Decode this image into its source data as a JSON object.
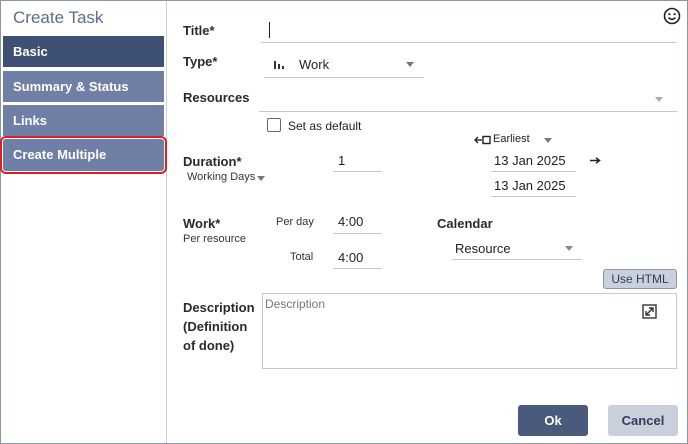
{
  "dialog": {
    "title": "Create Task"
  },
  "sidebar": {
    "items": [
      {
        "label": "Basic"
      },
      {
        "label": "Summary & Status"
      },
      {
        "label": "Links"
      },
      {
        "label": "Create Multiple"
      }
    ]
  },
  "form": {
    "title": {
      "label": "Title*",
      "value": ""
    },
    "type": {
      "label": "Type*",
      "value": "Work",
      "icon": "bar-chart-icon"
    },
    "resources": {
      "label": "Resources",
      "value": ""
    },
    "set_default": {
      "label": "Set as default",
      "checked": false
    },
    "duration": {
      "label": "Duration*",
      "unit": "Working Days",
      "value": "1"
    },
    "schedule": {
      "mode": "Earliest",
      "start_date": "13 Jan 2025",
      "end_date": "13 Jan 2025"
    },
    "work": {
      "label": "Work*",
      "sublabel": "Per resource",
      "per_day_label": "Per day",
      "per_day_value": "4:00",
      "total_label": "Total",
      "total_value": "4:00"
    },
    "calendar": {
      "label": "Calendar",
      "value": "Resource"
    },
    "use_html": {
      "label": "Use HTML"
    },
    "description": {
      "label_line1": "Description",
      "label_line2": "(Definition",
      "label_line3": "of done)",
      "placeholder": "Description"
    }
  },
  "footer": {
    "ok_label": "Ok",
    "cancel_label": "Cancel"
  },
  "colors": {
    "nav_active": "#3e5074",
    "nav_inactive": "#6f7fa5",
    "highlight_outline": "#e01e1e",
    "primary_button": "#4a5a7c",
    "secondary_button": "#c9d0dc"
  }
}
